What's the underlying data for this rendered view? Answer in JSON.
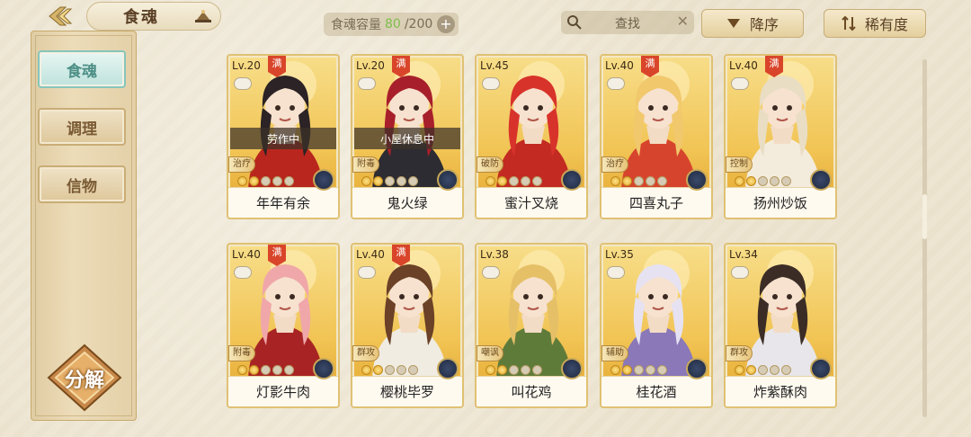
{
  "header": {
    "title": "食魂",
    "capacity_label": "食魂容量",
    "capacity_current": "80",
    "capacity_total": "/200",
    "capacity_add": "+",
    "search_placeholder": "查找",
    "search_clear": "✕",
    "sort_order_label": "降序",
    "sort_by_label": "稀有度"
  },
  "sidebar": {
    "tabs": [
      {
        "label": "食魂",
        "active": true
      },
      {
        "label": "调理",
        "active": false
      },
      {
        "label": "信物",
        "active": false
      }
    ],
    "decompose_label": "分解"
  },
  "cards": [
    {
      "level": "Lv.20",
      "full_badge": "满",
      "status": "劳作中",
      "role": "治疗",
      "stars": 2,
      "name": "年年有余",
      "hair": "#2b2325",
      "outfit": "#b8261d"
    },
    {
      "level": "Lv.20",
      "full_badge": "满",
      "status": "小屋休息中",
      "role": "附毒",
      "stars": 2,
      "name": "鬼火绿",
      "hair": "#a81f2c",
      "outfit": "#2c2c32"
    },
    {
      "level": "Lv.45",
      "full_badge": "",
      "status": "",
      "role": "破防",
      "stars": 2,
      "name": "蜜汁叉烧",
      "hair": "#d8332b",
      "outfit": "#c22a22"
    },
    {
      "level": "Lv.40",
      "full_badge": "满",
      "status": "",
      "role": "治疗",
      "stars": 2,
      "name": "四喜丸子",
      "hair": "#f1c86c",
      "outfit": "#d7442d"
    },
    {
      "level": "Lv.40",
      "full_badge": "满",
      "status": "",
      "role": "控制",
      "stars": 2,
      "name": "扬州炒饭",
      "hair": "#e9ddc4",
      "outfit": "#f3ecdc"
    },
    {
      "level": "Lv.40",
      "full_badge": "满",
      "status": "",
      "role": "附毒",
      "stars": 2,
      "name": "灯影牛肉",
      "hair": "#f0a7a9",
      "outfit": "#a82424"
    },
    {
      "level": "Lv.40",
      "full_badge": "满",
      "status": "",
      "role": "群攻",
      "stars": 2,
      "name": "樱桃毕罗",
      "hair": "#6b4127",
      "outfit": "#f0ece2"
    },
    {
      "level": "Lv.38",
      "full_badge": "",
      "status": "",
      "role": "嘲讽",
      "stars": 2,
      "name": "叫花鸡",
      "hair": "#e6c067",
      "outfit": "#5f7b3a"
    },
    {
      "level": "Lv.35",
      "full_badge": "",
      "status": "",
      "role": "辅助",
      "stars": 2,
      "name": "桂花酒",
      "hair": "#e6e2f2",
      "outfit": "#8a78b8"
    },
    {
      "level": "Lv.34",
      "full_badge": "",
      "status": "",
      "role": "群攻",
      "stars": 2,
      "name": "炸紫酥肉",
      "hair": "#3b2d26",
      "outfit": "#e8e6ea"
    }
  ],
  "colors": {
    "accent_teal": "#86c5bb",
    "gold": "#e0c173",
    "capacity_highlight": "#7dbf4b"
  }
}
